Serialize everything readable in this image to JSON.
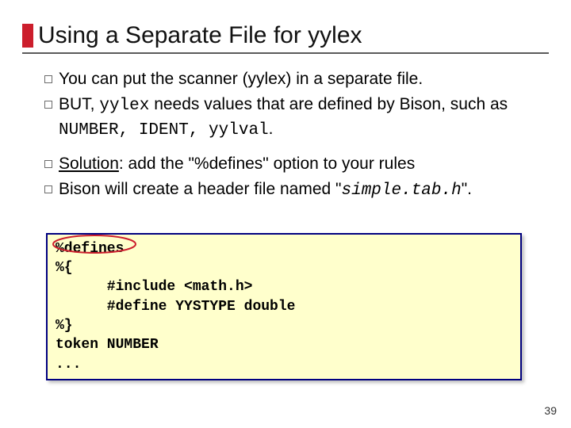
{
  "slide": {
    "title": "Using a Separate File for yylex",
    "bullets": {
      "b1": {
        "text": "You can put the scanner (yylex) in a separate file."
      },
      "b2": {
        "pre": "BUT, ",
        "code1": "yylex",
        "mid": " needs values that are defined by Bison, such as ",
        "code2": "NUMBER, IDENT, yylval",
        "post": "."
      },
      "b3": {
        "pre": "",
        "u": "Solution",
        "post": ": add the \"%defines\" option to your rules"
      },
      "b4": {
        "pre": "Bison will create a header file named \"",
        "code": "simple.tab.h",
        "post": "\"."
      }
    },
    "code": {
      "l1": "%defines",
      "l2": "%{",
      "l3": "      #include <math.h>",
      "l4": "      #define YYSTYPE double",
      "l5": "%}",
      "l6": "token NUMBER",
      "l7": "..."
    },
    "page": "39"
  }
}
